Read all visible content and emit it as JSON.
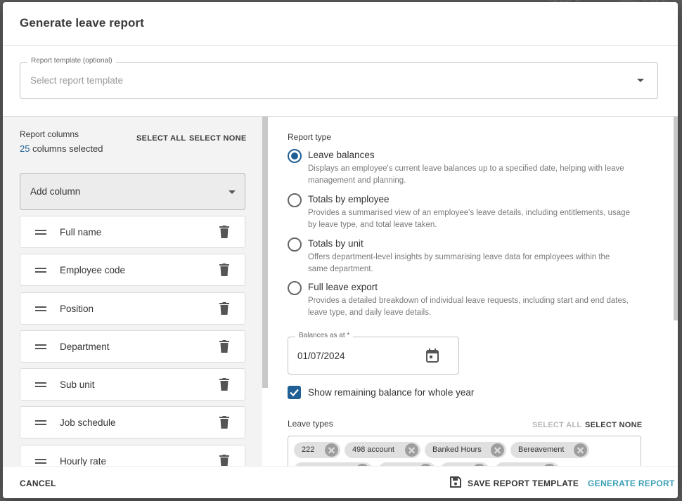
{
  "background": {
    "search": "SEARCH",
    "whats_new": "WHAT'S NEW"
  },
  "dialog": {
    "title": "Generate leave report"
  },
  "template": {
    "label": "Report template (optional)",
    "placeholder": "Select report template"
  },
  "columns": {
    "title": "Report columns",
    "count": "25",
    "count_suffix": " columns selected",
    "select_all": "SELECT ALL",
    "select_none": "SELECT NONE",
    "add_column": "Add column",
    "items": [
      "Full name",
      "Employee code",
      "Position",
      "Department",
      "Sub unit",
      "Job schedule",
      "Hourly rate"
    ]
  },
  "report_type": {
    "label": "Report type",
    "selected": "Leave balances",
    "options": [
      {
        "title": "Leave balances",
        "desc": "Displays an employee's current leave balances up to a specified date, helping with leave management and planning."
      },
      {
        "title": "Totals by employee",
        "desc": "Provides a summarised view of an employee's leave details, including entitlements, usage by leave type, and total leave taken."
      },
      {
        "title": "Totals by unit",
        "desc": "Offers department-level insights by summarising leave data for employees within the same department."
      },
      {
        "title": "Full leave export",
        "desc": "Provides a detailed breakdown of individual leave requests, including start and end dates, leave type, and daily leave details."
      }
    ]
  },
  "balances": {
    "label": "Balances as at *",
    "value": "01/07/2024"
  },
  "show_remaining": {
    "label": "Show remaining balance for whole year",
    "checked": true
  },
  "leave_types": {
    "label": "Leave types",
    "select_all": "SELECT ALL",
    "select_none": "SELECT NONE",
    "chips": [
      "222",
      "498 account",
      "Banked Hours",
      "Bereavement"
    ]
  },
  "footer": {
    "cancel": "CANCEL",
    "save_template": "SAVE REPORT TEMPLATE",
    "generate": "GENERATE REPORT"
  },
  "colors": {
    "accent": "#1f5f93",
    "generate_text": "#3a9fb5"
  }
}
